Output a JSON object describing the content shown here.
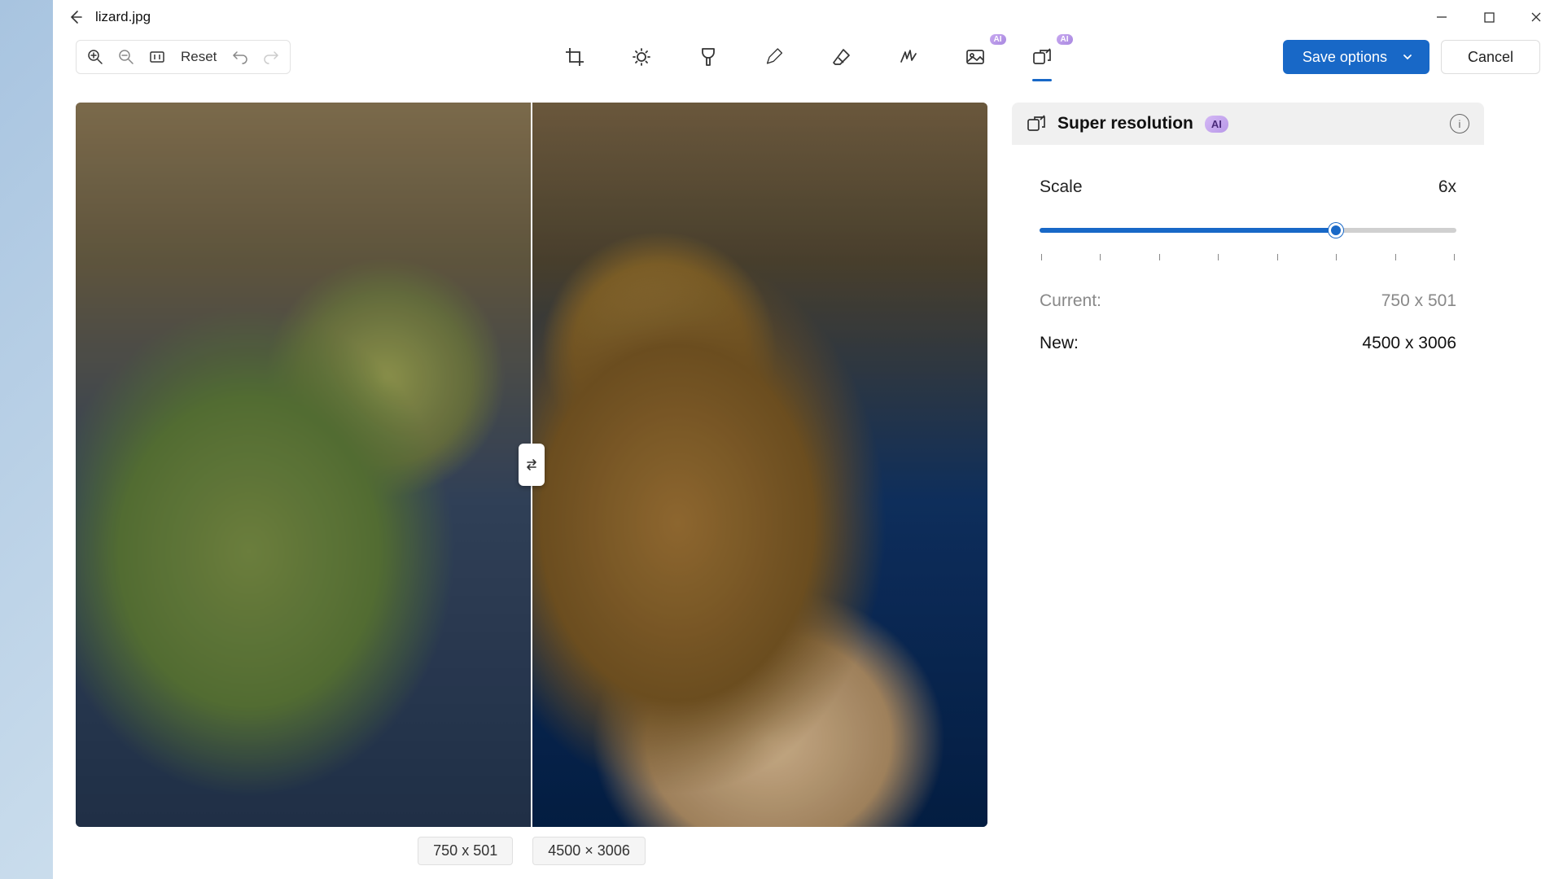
{
  "titlebar": {
    "filename": "lizard.jpg"
  },
  "toolbar": {
    "reset_label": "Reset",
    "save_label": "Save options",
    "cancel_label": "Cancel",
    "ai_badge": "AI"
  },
  "canvas": {
    "left_dim": "750 x 501",
    "right_dim": "4500 × 3006"
  },
  "panel": {
    "title": "Super resolution",
    "ai_chip": "AI",
    "scale_label": "Scale",
    "scale_value": "6x",
    "current_label": "Current:",
    "current_value": "750 x 501",
    "new_label": "New:",
    "new_value": "4500 x 3006"
  }
}
